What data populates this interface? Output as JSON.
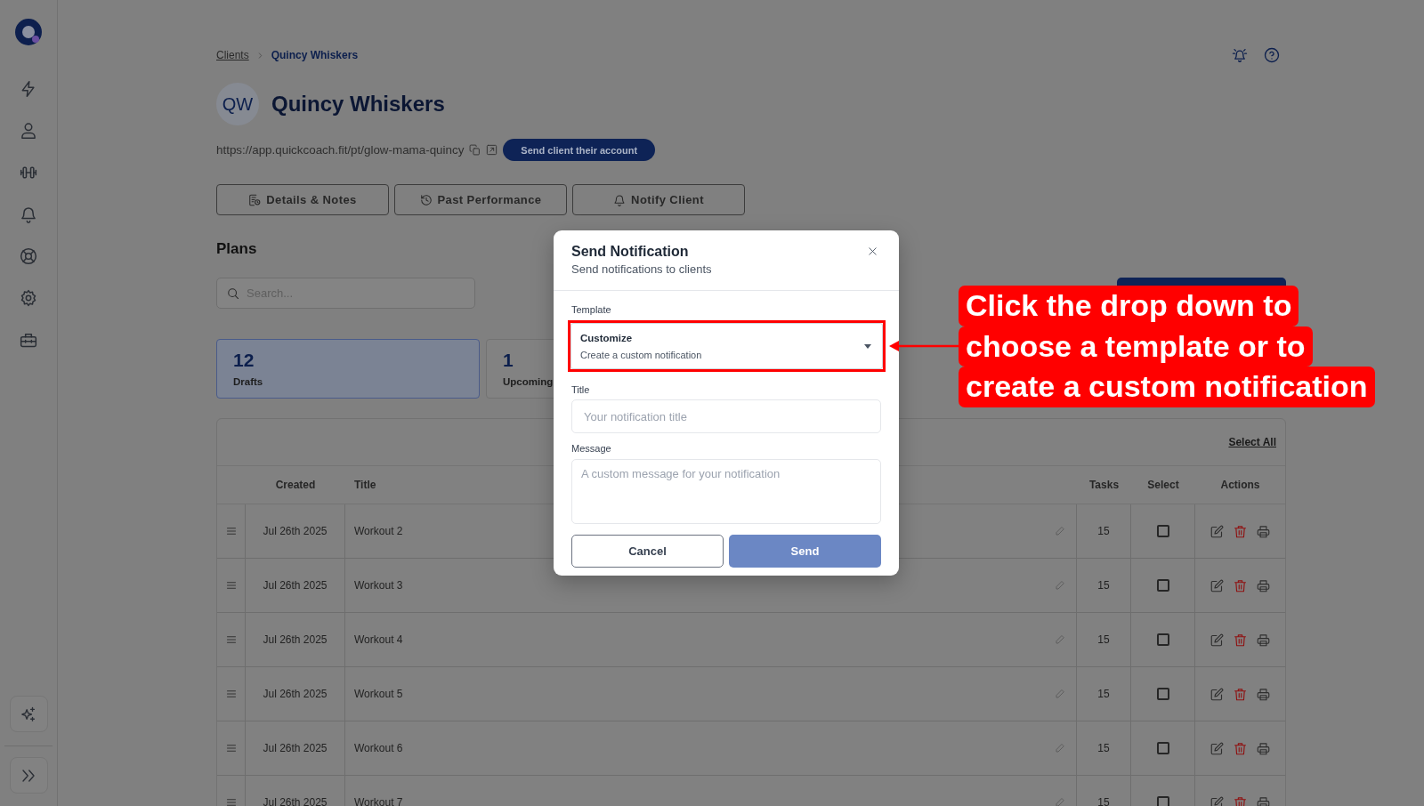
{
  "breadcrumb": [
    {
      "label": "Clients",
      "current": false
    },
    {
      "label": "Quincy Whiskers",
      "current": true
    }
  ],
  "client": {
    "initials": "QW",
    "name": "Quincy Whiskers",
    "url": "https://app.quickcoach.fit/pt/glow-mama-quincy",
    "send_button": "Send client their account"
  },
  "client_actions": [
    "Details & Notes",
    "Past Performance",
    "Notify Client"
  ],
  "plans": {
    "heading": "Plans",
    "search": {
      "placeholder": "Search..."
    },
    "stats": [
      {
        "count": "12",
        "label": "Drafts",
        "selected": true
      },
      {
        "count": "1",
        "label": "Upcoming",
        "selected": false
      }
    ],
    "select_all": "Select All",
    "columns": [
      "Created",
      "Title",
      "Tasks",
      "Select",
      "Actions"
    ],
    "rows": [
      {
        "created": "Jul 26th 2025",
        "title": "Workout 2",
        "tasks": "15",
        "checked": false
      },
      {
        "created": "Jul 26th 2025",
        "title": "Workout 3",
        "tasks": "15",
        "checked": false
      },
      {
        "created": "Jul 26th 2025",
        "title": "Workout 4",
        "tasks": "15",
        "checked": false
      },
      {
        "created": "Jul 26th 2025",
        "title": "Workout 5",
        "tasks": "15",
        "checked": false
      },
      {
        "created": "Jul 26th 2025",
        "title": "Workout 6",
        "tasks": "15",
        "checked": false
      },
      {
        "created": "Jul 26th 2025",
        "title": "Workout 7",
        "tasks": "15",
        "checked": false
      }
    ]
  },
  "modal": {
    "title": "Send Notification",
    "subtitle": "Send notifications to clients",
    "template": {
      "label": "Template",
      "value": "Customize",
      "description": "Create a custom notification"
    },
    "title_field": {
      "label": "Title",
      "placeholder": "Your notification title"
    },
    "message_field": {
      "label": "Message",
      "placeholder": "A custom message for your notification"
    },
    "buttons": [
      {
        "label": "Cancel",
        "kind": "secondary",
        "disabled": false
      },
      {
        "label": "Send",
        "kind": "primary",
        "disabled": true
      }
    ]
  },
  "annotation": {
    "lines": [
      "Click the drop down to",
      "choose a template or to",
      "create a custom notification"
    ]
  }
}
